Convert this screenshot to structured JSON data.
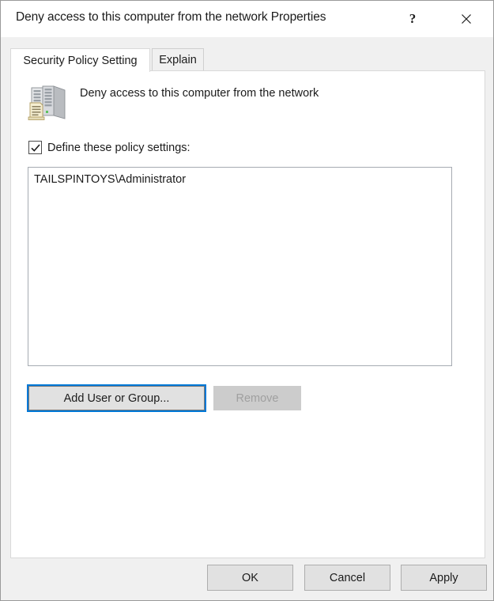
{
  "window": {
    "title": "Deny access to this computer from the network Properties",
    "help_label": "?",
    "close_label": "✕"
  },
  "tabs": [
    {
      "id": "security-policy-setting",
      "label": "Security Policy Setting",
      "active": true
    },
    {
      "id": "explain",
      "label": "Explain",
      "active": false
    }
  ],
  "policy": {
    "icon": "policy-server-icon",
    "name": "Deny access to this computer from the network",
    "define_checkbox": {
      "label": "Define these policy settings:",
      "checked": true
    },
    "entries": [
      "TAILSPINTOYS\\Administrator"
    ]
  },
  "list_actions": {
    "add_label": "Add User or Group...",
    "add_focused": true,
    "remove_label": "Remove",
    "remove_enabled": false
  },
  "footer": {
    "ok_label": "OK",
    "cancel_label": "Cancel",
    "apply_label": "Apply"
  },
  "colors": {
    "accent_focus": "#0078d7",
    "window_background": "#f0f0f0",
    "panel_background": "#ffffff",
    "button_face": "#e1e1e1",
    "disabled_face": "#cccccc",
    "disabled_text": "#a0a0a0",
    "text": "#1b1b1b"
  }
}
